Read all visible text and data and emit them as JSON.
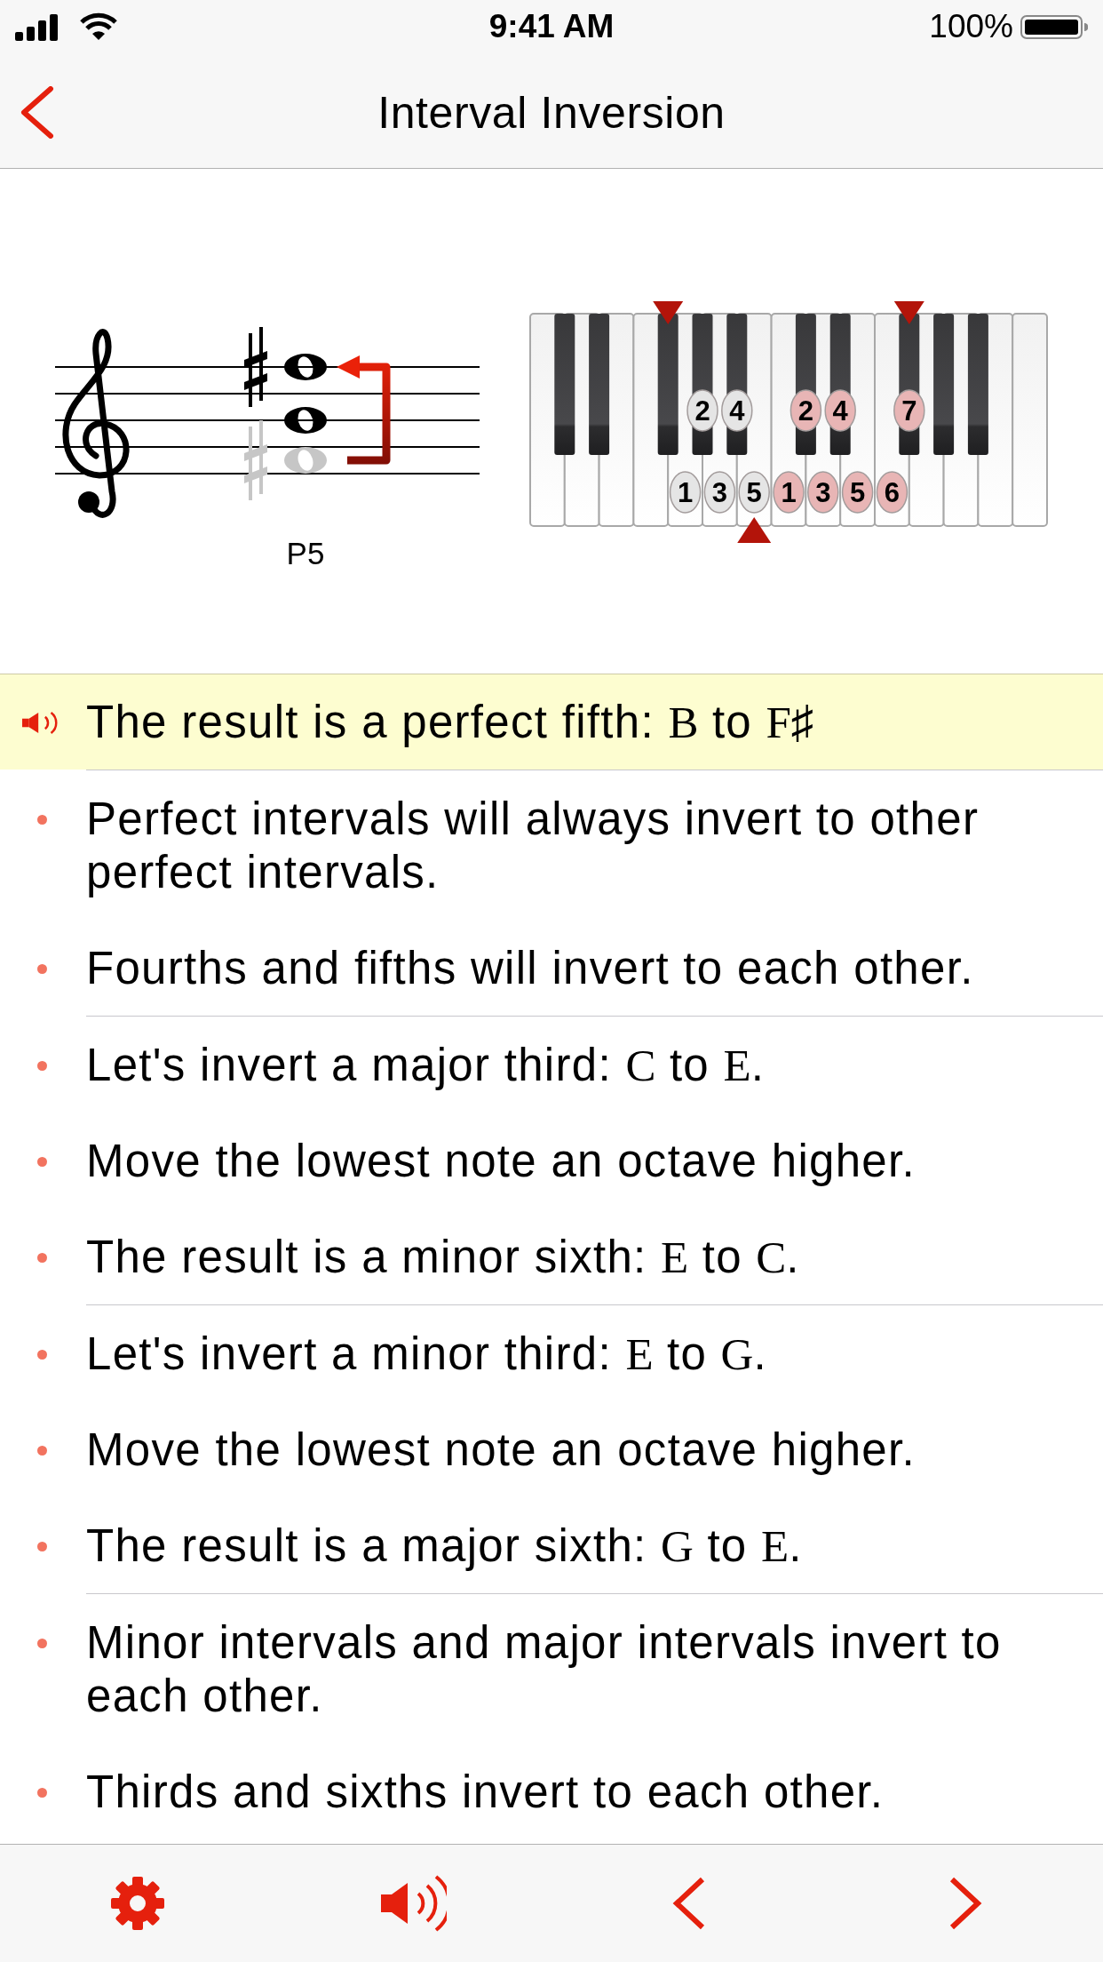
{
  "status_bar": {
    "time": "9:41 AM",
    "battery": "100%"
  },
  "nav": {
    "title": "Interval Inversion"
  },
  "figure": {
    "staff": {
      "notes": [
        {
          "sharp": true,
          "faded": false
        },
        {
          "sharp": false,
          "faded": false
        },
        {
          "sharp": true,
          "faded": true
        }
      ],
      "octave_arrow": true,
      "label": "P5"
    },
    "keyboard": {
      "black_keys": [
        {
          "marked": false
        },
        {
          "marked": false
        },
        {
          "marked": true
        },
        {
          "label": "2",
          "color": "#e5e5e5",
          "marked": false
        },
        {
          "label": "4",
          "color": "#e5e5e5",
          "marked": false
        },
        {
          "label": "2",
          "color": "#e8b5b5",
          "marked": false
        },
        {
          "label": "4",
          "color": "#e8b5b5",
          "marked": false
        },
        {
          "label": "7",
          "color": "#e8b5b5",
          "marked": true
        },
        {
          "marked": false
        },
        {
          "marked": false
        }
      ],
      "white_keys": [
        {
          "marked": false
        },
        {
          "marked": false
        },
        {
          "marked": false
        },
        {
          "marked": false
        },
        {
          "label": "1",
          "color": "#e5e5e5",
          "marked": false
        },
        {
          "label": "3",
          "color": "#e5e5e5",
          "marked": false
        },
        {
          "label": "5",
          "color": "#e5e5e5",
          "marked": true
        },
        {
          "label": "1",
          "color": "#e8b5b5",
          "marked": false
        },
        {
          "label": "3",
          "color": "#e8b5b5",
          "marked": false
        },
        {
          "label": "5",
          "color": "#e8b5b5",
          "marked": false
        },
        {
          "label": "6",
          "color": "#e8b5b5",
          "marked": false
        },
        {
          "marked": false
        },
        {
          "marked": false
        },
        {
          "marked": false
        },
        {
          "marked": false
        }
      ]
    }
  },
  "sections": [
    {
      "items": [
        {
          "selected": true,
          "parts": [
            {
              "kind": "text",
              "text": "The result is a perfect fifth: "
            },
            {
              "kind": "note",
              "text": "B"
            },
            {
              "kind": "text",
              "text": " to "
            },
            {
              "kind": "note",
              "text": "F♯"
            }
          ]
        }
      ]
    },
    {
      "items": [
        {
          "selected": false,
          "parts": [
            {
              "kind": "text",
              "text": "Perfect intervals will always invert to other perfect intervals."
            }
          ]
        },
        {
          "selected": false,
          "parts": [
            {
              "kind": "text",
              "text": "Fourths and fifths will invert to each other."
            }
          ]
        }
      ]
    },
    {
      "items": [
        {
          "selected": false,
          "parts": [
            {
              "kind": "text",
              "text": "Let's invert a major third: "
            },
            {
              "kind": "note",
              "text": "C"
            },
            {
              "kind": "text",
              "text": " to "
            },
            {
              "kind": "note",
              "text": "E"
            },
            {
              "kind": "text",
              "text": "."
            }
          ]
        },
        {
          "selected": false,
          "parts": [
            {
              "kind": "text",
              "text": "Move the lowest note an octave higher."
            }
          ]
        },
        {
          "selected": false,
          "parts": [
            {
              "kind": "text",
              "text": "The result is a minor sixth: "
            },
            {
              "kind": "note",
              "text": "E"
            },
            {
              "kind": "text",
              "text": " to "
            },
            {
              "kind": "note",
              "text": "C"
            },
            {
              "kind": "text",
              "text": "."
            }
          ]
        }
      ]
    },
    {
      "items": [
        {
          "selected": false,
          "parts": [
            {
              "kind": "text",
              "text": "Let's invert a minor third: "
            },
            {
              "kind": "note",
              "text": "E"
            },
            {
              "kind": "text",
              "text": " to "
            },
            {
              "kind": "note",
              "text": "G"
            },
            {
              "kind": "text",
              "text": "."
            }
          ]
        },
        {
          "selected": false,
          "parts": [
            {
              "kind": "text",
              "text": "Move the lowest note an octave higher."
            }
          ]
        },
        {
          "selected": false,
          "parts": [
            {
              "kind": "text",
              "text": "The result is a major sixth: "
            },
            {
              "kind": "note",
              "text": "G"
            },
            {
              "kind": "text",
              "text": " to "
            },
            {
              "kind": "note",
              "text": "E"
            },
            {
              "kind": "text",
              "text": "."
            }
          ]
        }
      ]
    },
    {
      "items": [
        {
          "selected": false,
          "parts": [
            {
              "kind": "text",
              "text": "Minor intervals and major intervals invert to each other."
            }
          ]
        },
        {
          "selected": false,
          "parts": [
            {
              "kind": "text",
              "text": "Thirds and sixths invert to each other."
            }
          ]
        }
      ]
    }
  ]
}
